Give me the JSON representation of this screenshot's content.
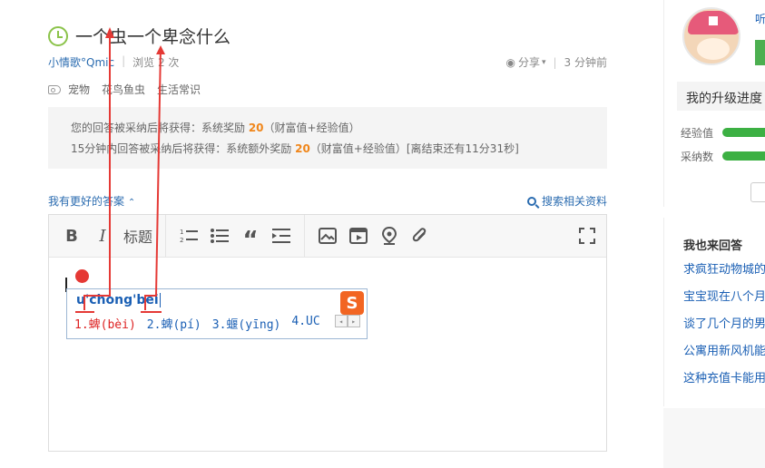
{
  "question": {
    "title": "一个虫一个卑念什么",
    "user": "小情歌°Qmic",
    "views": "浏览 2 次",
    "share_label": "分享",
    "time_ago": "3 分钟前",
    "tags": [
      "宠物",
      "花鸟鱼虫",
      "生活常识"
    ]
  },
  "reward": {
    "line1_prefix": "您的回答被采纳后将获得：系统奖励 ",
    "line1_value": "20",
    "line1_suffix": "（财富值+经验值）",
    "line2_prefix": "15分钟内回答被采纳后将获得：系统额外奖励 ",
    "line2_value": "20",
    "line2_suffix": "（财富值+经验值）[离结束还有11分31秒]"
  },
  "answer": {
    "better_answer_label": "我有更好的答案",
    "search_related_label": "搜索相关资料"
  },
  "toolbar": {
    "bold": "B",
    "italic": "I",
    "title": "标题",
    "ordered_list_icon": "ordered-list-icon",
    "unordered_list_icon": "unordered-list-icon",
    "quote": "“",
    "indent_icon": "indent-icon",
    "image_icon": "image-icon",
    "video_icon": "video-icon",
    "location_icon": "location-icon",
    "attach_icon": "paperclip-icon",
    "fullscreen_icon": "fullscreen-icon"
  },
  "ime": {
    "composition": "u'chong'bei",
    "logo": "S",
    "candidates": [
      "1.蜱(bèi)",
      "2.蜱(pí)",
      "3.蝘(yīng)",
      "4.UC"
    ],
    "pager_prev": "◂",
    "pager_next": "▸"
  },
  "sidebar": {
    "username": "听",
    "upgrade_label": "我的升级进度",
    "exp_label": "经验值",
    "exp_progress": 0.9,
    "adopt_label": "采纳数",
    "adopt_progress": 0.9,
    "answer_title": "我也来回答",
    "answer_items": [
      "求疯狂动物城的",
      "宝宝现在八个月",
      "谈了几个月的男",
      "公寓用新风机能",
      "这种充值卡能用"
    ]
  },
  "colors": {
    "accent_blue": "#2b6cb0",
    "reward_orange": "#f0861a",
    "progress_green": "#3cb043",
    "annotation_red": "#e53935"
  }
}
